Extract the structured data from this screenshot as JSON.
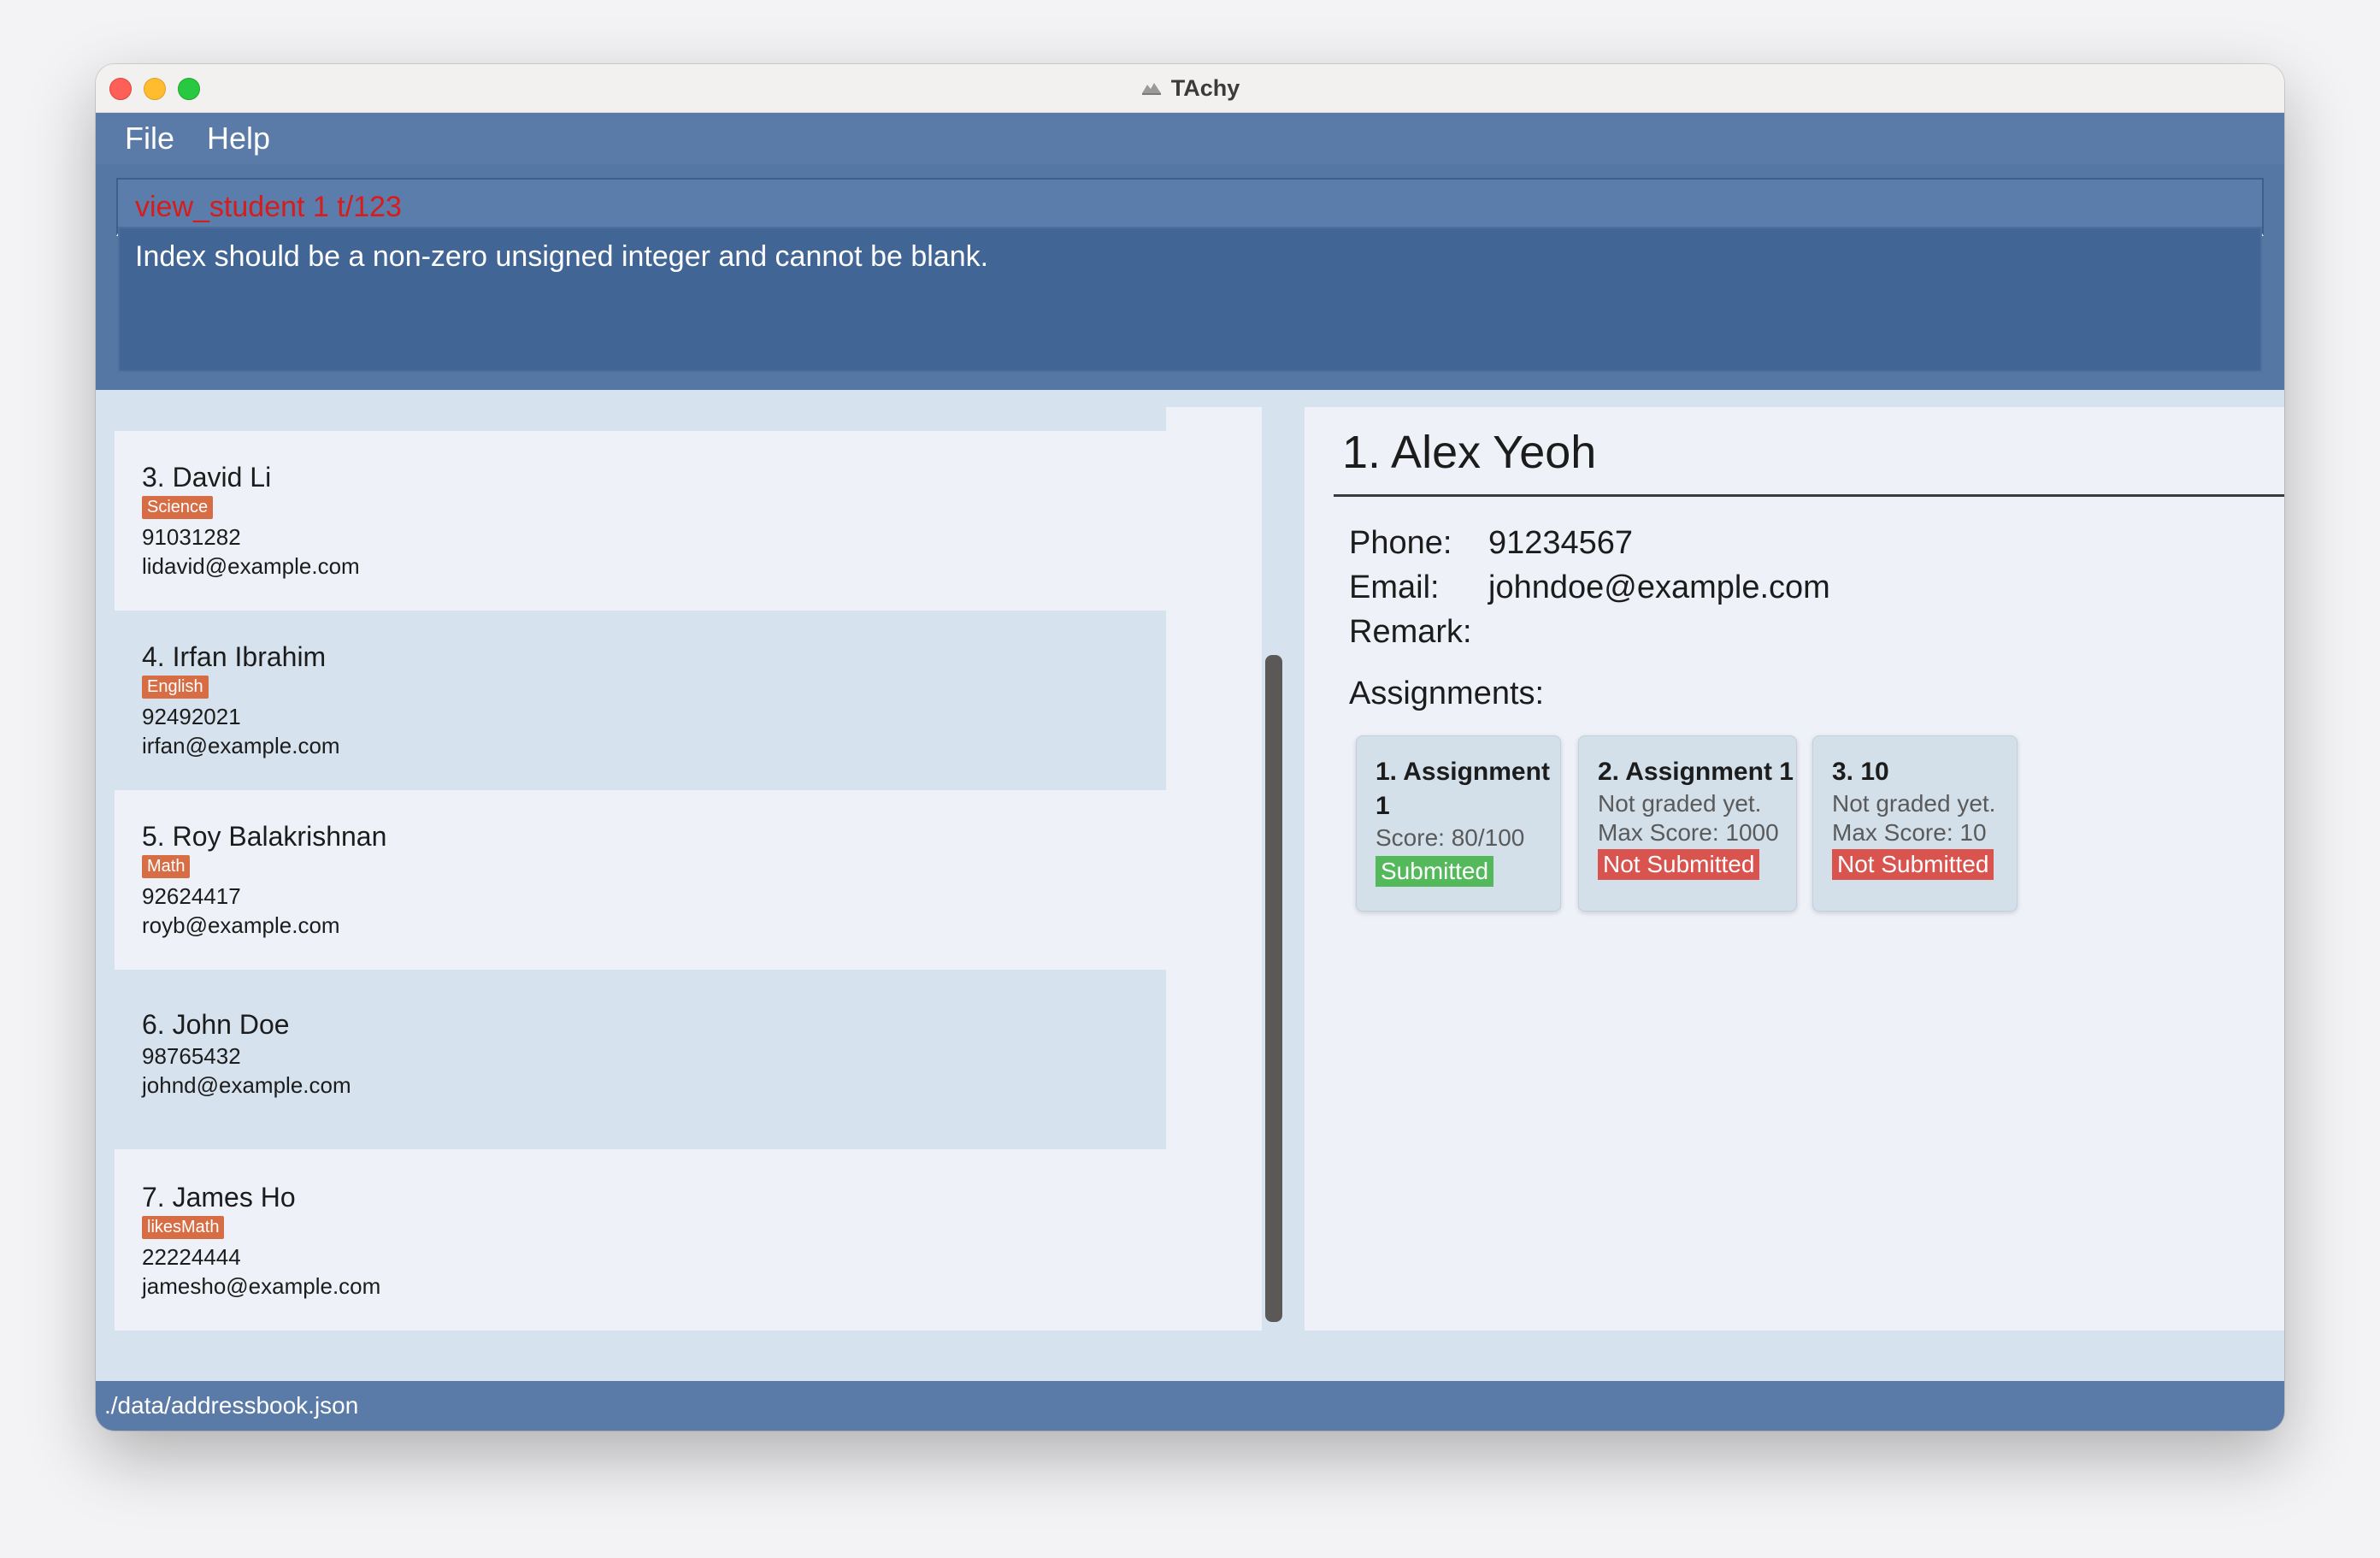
{
  "window": {
    "title": "TAchy"
  },
  "menu": {
    "file": "File",
    "help": "Help"
  },
  "command": {
    "value": "view_student 1 t/123"
  },
  "result": {
    "message": "Index should be a non-zero unsigned integer and cannot be blank."
  },
  "students": [
    {
      "name": "3. David Li",
      "tag": "Science",
      "phone": "91031282",
      "email": "lidavid@example.com"
    },
    {
      "name": "4. Irfan Ibrahim",
      "tag": "English",
      "phone": "92492021",
      "email": "irfan@example.com"
    },
    {
      "name": "5. Roy Balakrishnan",
      "tag": "Math",
      "phone": "92624417",
      "email": "royb@example.com"
    },
    {
      "name": "6. John Doe",
      "tag": "",
      "phone": "98765432",
      "email": "johnd@example.com"
    },
    {
      "name": "7. James Ho",
      "tag": "likesMath",
      "phone": "22224444",
      "email": "jamesho@example.com"
    }
  ],
  "detail": {
    "name": "1. Alex Yeoh",
    "phone_label": "Phone:",
    "phone": "91234567",
    "email_label": "Email:",
    "email": "johndoe@example.com",
    "remark_label": "Remark:",
    "remark": "",
    "assignments_label": "Assignments:",
    "assignments": [
      {
        "title": "1. Assignment 1",
        "line1": "Score: 80/100",
        "line2": "",
        "status": "Submitted"
      },
      {
        "title": "2. Assignment 1",
        "line1": "Not graded yet.",
        "line2": "Max Score: 1000",
        "status": "Not Submitted"
      },
      {
        "title": "3. 10",
        "line1": "Not graded yet.",
        "line2": "Max Score: 10",
        "status": "Not Submitted"
      }
    ]
  },
  "status": {
    "path": "./data/addressbook.json"
  },
  "colors": {
    "menu_bg": "#5a7aa8",
    "tag": "#d76d45",
    "submitted": "#54b95b",
    "not_submitted": "#d9534f",
    "command_error": "#d81b1b"
  }
}
